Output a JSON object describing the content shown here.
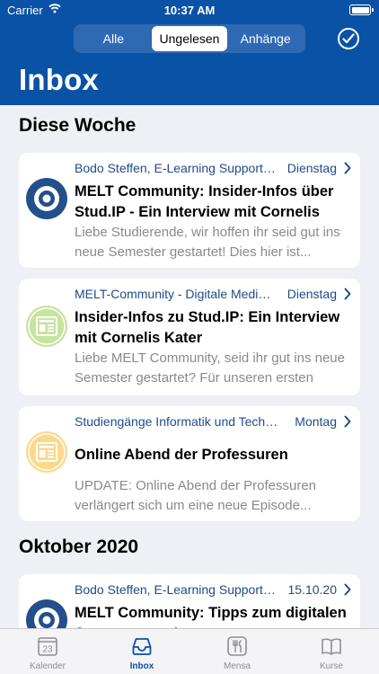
{
  "status_bar": {
    "carrier": "Carrier",
    "time": "10:37 AM"
  },
  "header": {
    "segments": [
      "Alle",
      "Ungelesen",
      "Anhänge"
    ],
    "active_segment": "Ungelesen",
    "title": "Inbox"
  },
  "sections": [
    {
      "title": "Diese Woche"
    },
    {
      "title": "Oktober 2020"
    }
  ],
  "messages": [
    {
      "sender": "Bodo Steffen, E-Learning Support, Center für Digitale Systeme",
      "date": "Dienstag",
      "subject": "MELT Community: Insider-Infos über Stud.IP - Ein Interview mit Cornelis Kater",
      "preview": "Liebe Studierende, wir hoffen ihr seid gut ins neue Semester gestartet! Dies hier ist...",
      "icon": "avatar-icon"
    },
    {
      "sender": "MELT-Community - Digitale Medien in Lehre und Forschung",
      "date": "Dienstag",
      "subject": "Insider-Infos zu Stud.IP: Ein Interview mit Cornelis Kater",
      "preview": "Liebe MELT Community, seid ihr gut ins neue Semester gestartet? Für unseren ersten Beitrag...",
      "icon": "news-icon"
    },
    {
      "sender": "Studiengänge Informatik und Technische Informatik",
      "date": "Montag",
      "subject": "Online Abend der Professuren",
      "preview": "UPDATE: Online Abend der Professuren verlängert sich um eine neue Episode...",
      "icon": "news-icon"
    },
    {
      "sender": "Bodo Steffen, E-Learning Support, Center für Digitale Systeme",
      "date": "15.10.20",
      "subject": "MELT Community: Tipps zum digitalen Semesterstart!",
      "preview": "",
      "icon": "avatar-icon"
    }
  ],
  "tabs": [
    {
      "label": "Kalender",
      "icon": "calendar-icon",
      "badge": "23"
    },
    {
      "label": "Inbox",
      "icon": "inbox-icon"
    },
    {
      "label": "Mensa",
      "icon": "cutlery-icon"
    },
    {
      "label": "Kurse",
      "icon": "book-icon"
    }
  ],
  "colors": {
    "header_blue": "#0a52a5",
    "link_blue": "#1e4b8a",
    "green_icon": "#c7e3a0",
    "yellow_icon": "#fbd98b"
  }
}
